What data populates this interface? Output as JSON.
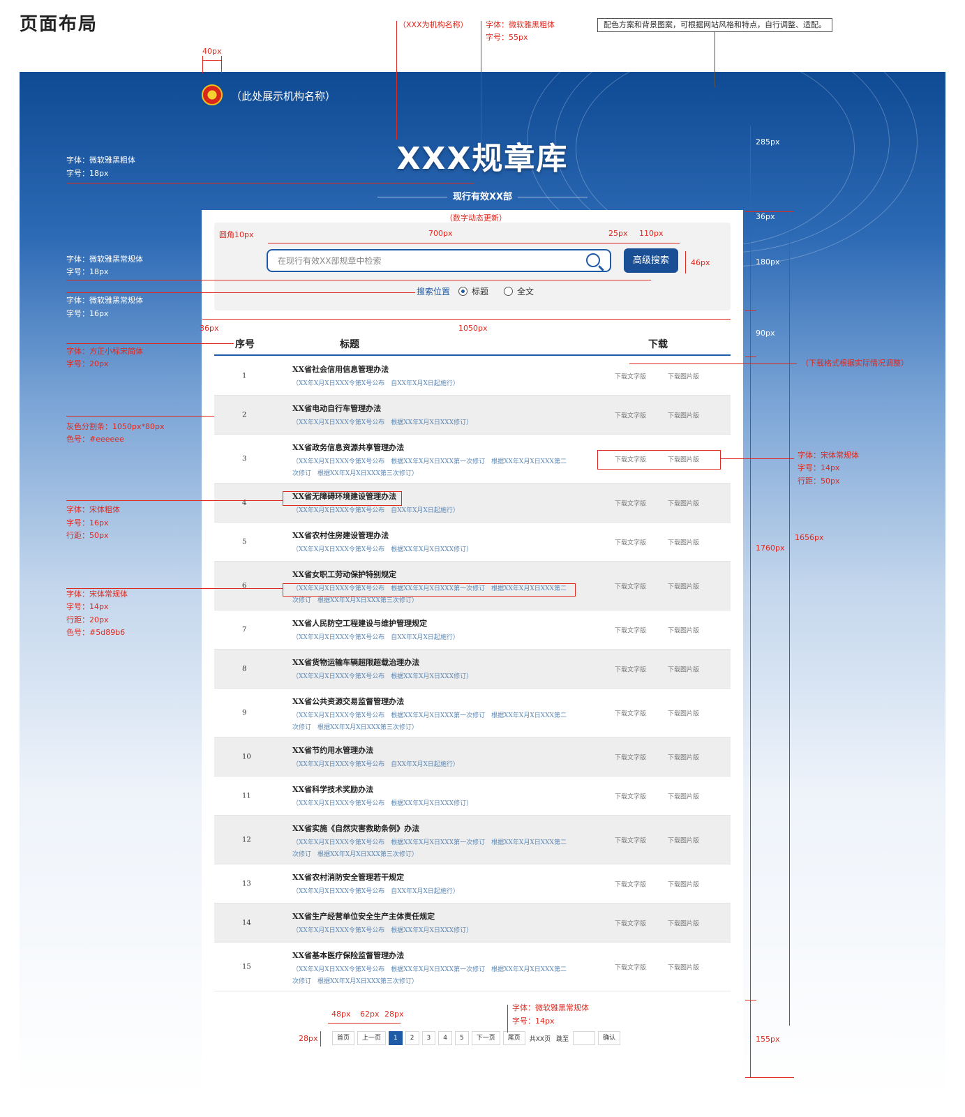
{
  "page_heading": "页面布局",
  "header": {
    "org_name": "（此处展示机构名称）",
    "site_title": "XXX规章库",
    "effective_count": "现行有效XX部"
  },
  "search": {
    "placeholder": "在现行有效XX部规章中检索",
    "advanced_button": "高级搜索",
    "position_label": "搜索位置",
    "options": [
      "标题",
      "全文"
    ]
  },
  "table": {
    "headers": {
      "num": "序号",
      "title": "标题",
      "download": "下载"
    },
    "download_text": "下载文字版",
    "download_image": "下载图片版",
    "rows": [
      {
        "num": "1",
        "title": "XX省社会信用信息管理办法",
        "meta": "（XX年X月X日XXX令第X号公布　自XX年X月X日起施行）"
      },
      {
        "num": "2",
        "title": "XX省电动自行车管理办法",
        "meta": "（XX年X月X日XXX令第X号公布　根据XX年X月X日XXX修订）"
      },
      {
        "num": "3",
        "title": "XX省政务信息资源共享管理办法",
        "meta": "（XX年X月X日XXX令第X号公布　根据XX年X月X日XXX第一次修订　根据XX年X月X日XXX第二次修订　根据XX年X月X日XXX第三次修订）"
      },
      {
        "num": "4",
        "title": "XX省无障碍环境建设管理办法",
        "meta": "（XX年X月X日XXX令第X号公布　自XX年X月X日起施行）"
      },
      {
        "num": "5",
        "title": "XX省农村住房建设管理办法",
        "meta": "（XX年X月X日XXX令第X号公布　根据XX年X月X日XXX修订）"
      },
      {
        "num": "6",
        "title": "XX省女职工劳动保护特别规定",
        "meta": "（XX年X月X日XXX令第X号公布　根据XX年X月X日XXX第一次修订　根据XX年X月X日XXX第二次修订　根据XX年X月X日XXX第三次修订）"
      },
      {
        "num": "7",
        "title": "XX省人民防空工程建设与维护管理规定",
        "meta": "（XX年X月X日XXX令第X号公布　自XX年X月X日起施行）"
      },
      {
        "num": "8",
        "title": "XX省货物运输车辆超限超载治理办法",
        "meta": "（XX年X月X日XXX令第X号公布　根据XX年X月X日XXX修订）"
      },
      {
        "num": "9",
        "title": "XX省公共资源交易监督管理办法",
        "meta": "（XX年X月X日XXX令第X号公布　根据XX年X月X日XXX第一次修订　根据XX年X月X日XXX第二次修订　根据XX年X月X日XXX第三次修订）"
      },
      {
        "num": "10",
        "title": "XX省节约用水管理办法",
        "meta": "（XX年X月X日XXX令第X号公布　自XX年X月X日起施行）"
      },
      {
        "num": "11",
        "title": "XX省科学技术奖励办法",
        "meta": "（XX年X月X日XXX令第X号公布　根据XX年X月X日XXX修订）"
      },
      {
        "num": "12",
        "title": "XX省实施《自然灾害救助条例》办法",
        "meta": "（XX年X月X日XXX令第X号公布　根据XX年X月X日XXX第一次修订　根据XX年X月X日XXX第二次修订　根据XX年X月X日XXX第三次修订）"
      },
      {
        "num": "13",
        "title": "XX省农村消防安全管理若干规定",
        "meta": "（XX年X月X日XXX令第X号公布　自XX年X月X日起施行）"
      },
      {
        "num": "14",
        "title": "XX省生产经营单位安全生产主体责任规定",
        "meta": "（XX年X月X日XXX令第X号公布　根据XX年X月X日XXX修订）"
      },
      {
        "num": "15",
        "title": "XX省基本医疗保险监督管理办法",
        "meta": "（XX年X月X日XXX令第X号公布　根据XX年X月X日XXX第一次修订　根据XX年X月X日XXX第二次修订　根据XX年X月X日XXX第三次修订）"
      }
    ]
  },
  "pager": {
    "first": "首页",
    "prev": "上一页",
    "pages": [
      "1",
      "2",
      "3",
      "4",
      "5"
    ],
    "current": "1",
    "next": "下一页",
    "last": "尾页",
    "total": "共XX页",
    "jump": "跳至",
    "confirm": "确认"
  },
  "annotations": {
    "org_note": "（XXX为机构名称）",
    "title_font": "字体：微软雅黑粗体",
    "title_size": "字号：55px",
    "color_note": "配色方案和背景图案，可根据网站风格和特点，自行调整、适配。",
    "w40": "40px",
    "h285": "285px",
    "count_font": "字体：微软雅黑粗体",
    "count_size": "字号：18px",
    "dynamic_note": "（数字动态更新）",
    "h36": "36px",
    "radius": "圆角10px",
    "w700": "700px",
    "w25": "25px",
    "w110": "110px",
    "h46": "46px",
    "h180": "180px",
    "input_font": "字体：微软雅黑常规体",
    "input_size": "字号：18px",
    "pos_font": "字体：微软雅黑常规体",
    "pos_size": "字号：16px",
    "w36": "36px",
    "w1050": "1050px",
    "h90": "90px",
    "head_font": "字体：方正小标宋简体",
    "head_size": "字号：20px",
    "dl_note": "（下载格式根据实际情况调整）",
    "divider": "灰色分割条：1050px*80px",
    "divider_color": "色号：#eeeeee",
    "dl_font": "字体：宋体常规体",
    "dl_size": "字号：14px",
    "dl_line": "行距：50px",
    "row_font": "字体：宋体粗体",
    "row_size": "字号：16px",
    "row_line": "行距：50px",
    "h1656": "1656px",
    "h1760": "1760px",
    "meta_font": "字体：宋体常规体",
    "meta_size": "字号：14px",
    "meta_line": "行距：20px",
    "meta_color": "色号：#5d89b6",
    "w48": "48px",
    "w62": "62px",
    "w28": "28px",
    "h28": "28px",
    "pager_font": "字体：微软雅黑常规体",
    "pager_size": "字号：14px",
    "h155": "155px"
  },
  "colors": {
    "primary": "#1f5aa6",
    "divider": "#eeeeee",
    "meta": "#5d89b6",
    "annotation": "#e0281d"
  }
}
